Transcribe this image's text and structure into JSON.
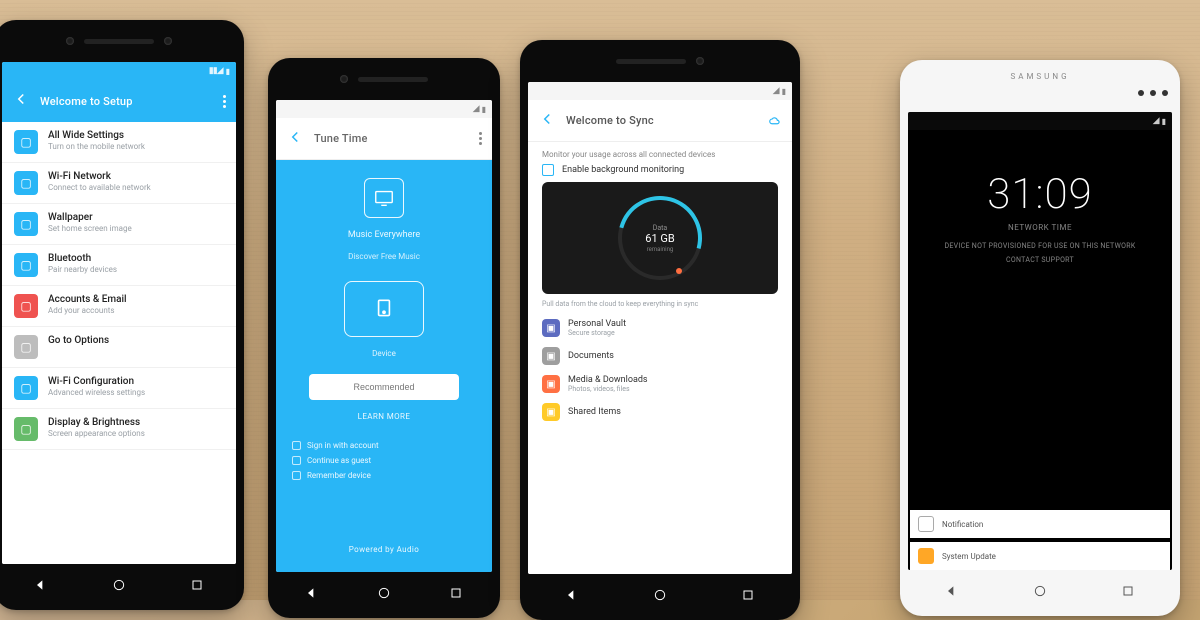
{
  "phone1": {
    "statusbar_time": "",
    "appbar_title": "Welcome to Setup",
    "rows": [
      {
        "color": "#29b6f6",
        "title": "All Wide Settings",
        "sub": "Turn on the mobile network"
      },
      {
        "color": "#29b6f6",
        "title": "Wi-Fi Network",
        "sub": "Connect to available network"
      },
      {
        "color": "#29b6f6",
        "title": "Wallpaper",
        "sub": "Set home screen image"
      },
      {
        "color": "#29b6f6",
        "title": "Bluetooth",
        "sub": "Pair nearby devices"
      },
      {
        "color": "#ef5350",
        "title": "Accounts & Email",
        "sub": "Add your accounts"
      },
      {
        "color": "#bdbdbd",
        "title": "Go to Options",
        "sub": ""
      },
      {
        "color": "#29b6f6",
        "title": "Wi-Fi Configuration",
        "sub": "Advanced wireless settings"
      },
      {
        "color": "#66bb6a",
        "title": "Display & Brightness",
        "sub": "Screen appearance options"
      }
    ]
  },
  "phone2": {
    "appbar_title": "Tune Time",
    "hero_label": "Music Everywhere",
    "card_label": "Discover Free Music",
    "button_label": "Recommended",
    "link_label": "LEARN MORE",
    "opts": [
      "Sign in with account",
      "Continue as guest",
      "Remember device"
    ],
    "footer": "Powered by Audio"
  },
  "phone3": {
    "appbar_title": "Welcome to Sync",
    "intro": "Monitor your usage across all connected devices",
    "checkbox_label": "Enable background monitoring",
    "ring_center_top": "Data",
    "ring_center_value": "61 GB",
    "ring_center_sub": "remaining",
    "caption": "Pull data from the cloud to keep everything in sync",
    "items": [
      {
        "color": "#5c6bc0",
        "title": "Personal Vault",
        "sub": "Secure storage"
      },
      {
        "color": "#9e9e9e",
        "title": "Documents",
        "sub": ""
      },
      {
        "color": "#ff7043",
        "title": "Media & Downloads",
        "sub": "Photos, videos, files"
      },
      {
        "color": "#ffca28",
        "title": "Shared Items",
        "sub": ""
      }
    ]
  },
  "phone4": {
    "brand": "SAMSUNG",
    "clock": "31:09",
    "clock_sub": "Network Time",
    "lock_msg1": "Device not provisioned for use on this network",
    "lock_msg2": "Contact support",
    "card1": "Notification",
    "card2": "System Update"
  }
}
